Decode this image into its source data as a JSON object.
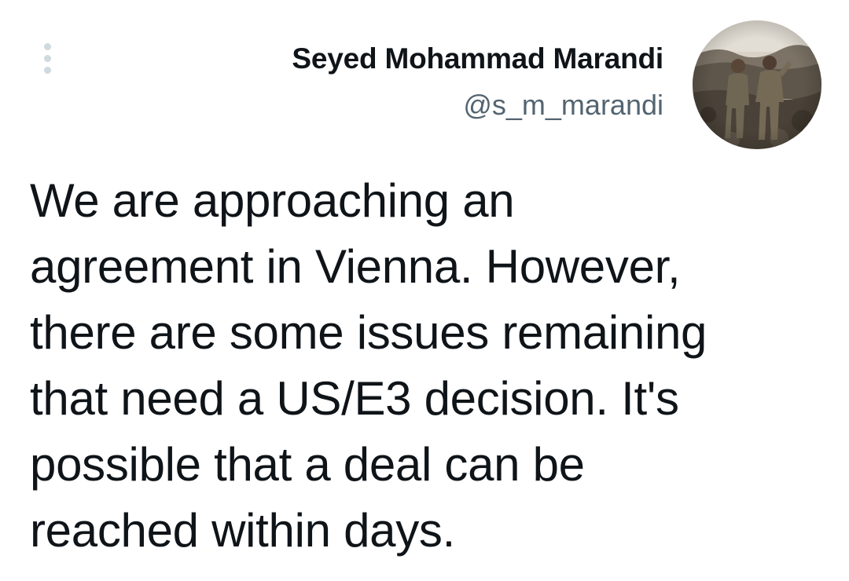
{
  "tweet": {
    "author": {
      "display_name": "Seyed Mohammad Marandi",
      "handle": "@s_m_marandi",
      "avatar_icon": "profile-photo"
    },
    "more_icon": "more-dots-vertical-icon",
    "text": "We are approaching an\nagreement in Vienna. However,\nthere are some issues remaining\nthat need a US/E3 decision. It's\npossible that a deal can be\nreached within days."
  },
  "colors": {
    "text": "#0f1419",
    "secondary_text": "#536471",
    "icon_muted": "#cfd9de",
    "background": "#ffffff"
  }
}
